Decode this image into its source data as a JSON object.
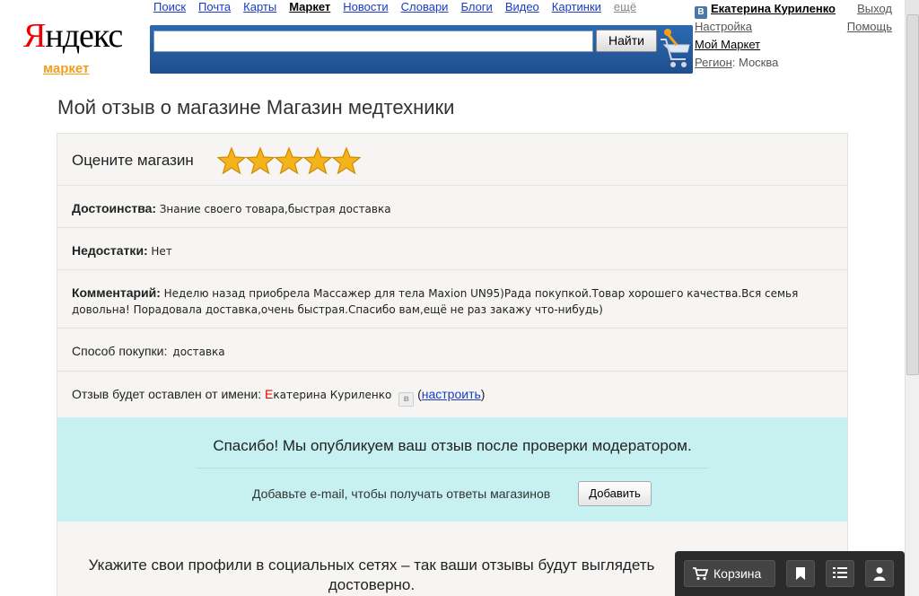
{
  "logo": {
    "brand": "Яндекс",
    "brand_first": "Я",
    "brand_rest": "ндекс",
    "service": "маркет"
  },
  "topnav": {
    "items": [
      "Поиск",
      "Почта",
      "Карты",
      "Маркет",
      "Новости",
      "Словари",
      "Блоги",
      "Видео",
      "Картинки",
      "ещё"
    ],
    "active": "Маркет"
  },
  "search": {
    "value": "",
    "button_label": "Найти"
  },
  "user": {
    "badge": "В",
    "name": "Екатерина Куриленко",
    "logout": "Выход",
    "settings": "Настройка",
    "help": "Помощь",
    "my_market": "Мой Маркет",
    "region_label": "Регион",
    "region_value": ": Москва"
  },
  "page": {
    "title": "Мой отзыв о магазине Магазин медтехники"
  },
  "review": {
    "rate_label": "Оцените магазин",
    "rating": 5,
    "rating_max": 5,
    "pros_label": "Достоинства:",
    "pros_value": "Знание своего товара,быстрая доставка",
    "cons_label": "Недостатки:",
    "cons_value": "Нет",
    "comment_label": "Комментарий:",
    "comment_value": "Неделю назад приобрела Массажер для тела Maxion UN95)Рада покупкой.Товар хорошего качества.Вся семья довольна! Порадовала доставка,очень быстрая.Спасибо вам,ещё не раз закажу что-нибудь)",
    "method_label": "Способ покупки:",
    "method_value": "доставка",
    "author_label": "Отзыв будет оставлен от имени:",
    "author_first_letter": "Е",
    "author_rest": "катерина Куриленко",
    "author_vk": "в",
    "configure_open": "(",
    "configure_link": "настроить",
    "configure_close": ")"
  },
  "thanks": {
    "title": "Спасибо! Мы опубликуем ваш отзыв после проверки модератором.",
    "email_prompt": "Добавьте e-mail, чтобы получать ответы магазинов",
    "add_button": "Добавить"
  },
  "social": {
    "text": "Укажите свои профили в социальных сетях – так ваши отзывы будут выглядеть достоверно."
  },
  "toolbar": {
    "cart_label": "Корзина"
  },
  "colors": {
    "star": "#f5b21a",
    "brand_red": "#ee0000",
    "market_orange": "#f0a01a",
    "thanks_bg": "#c7f1f1",
    "search_band": "#2d6ab0"
  }
}
